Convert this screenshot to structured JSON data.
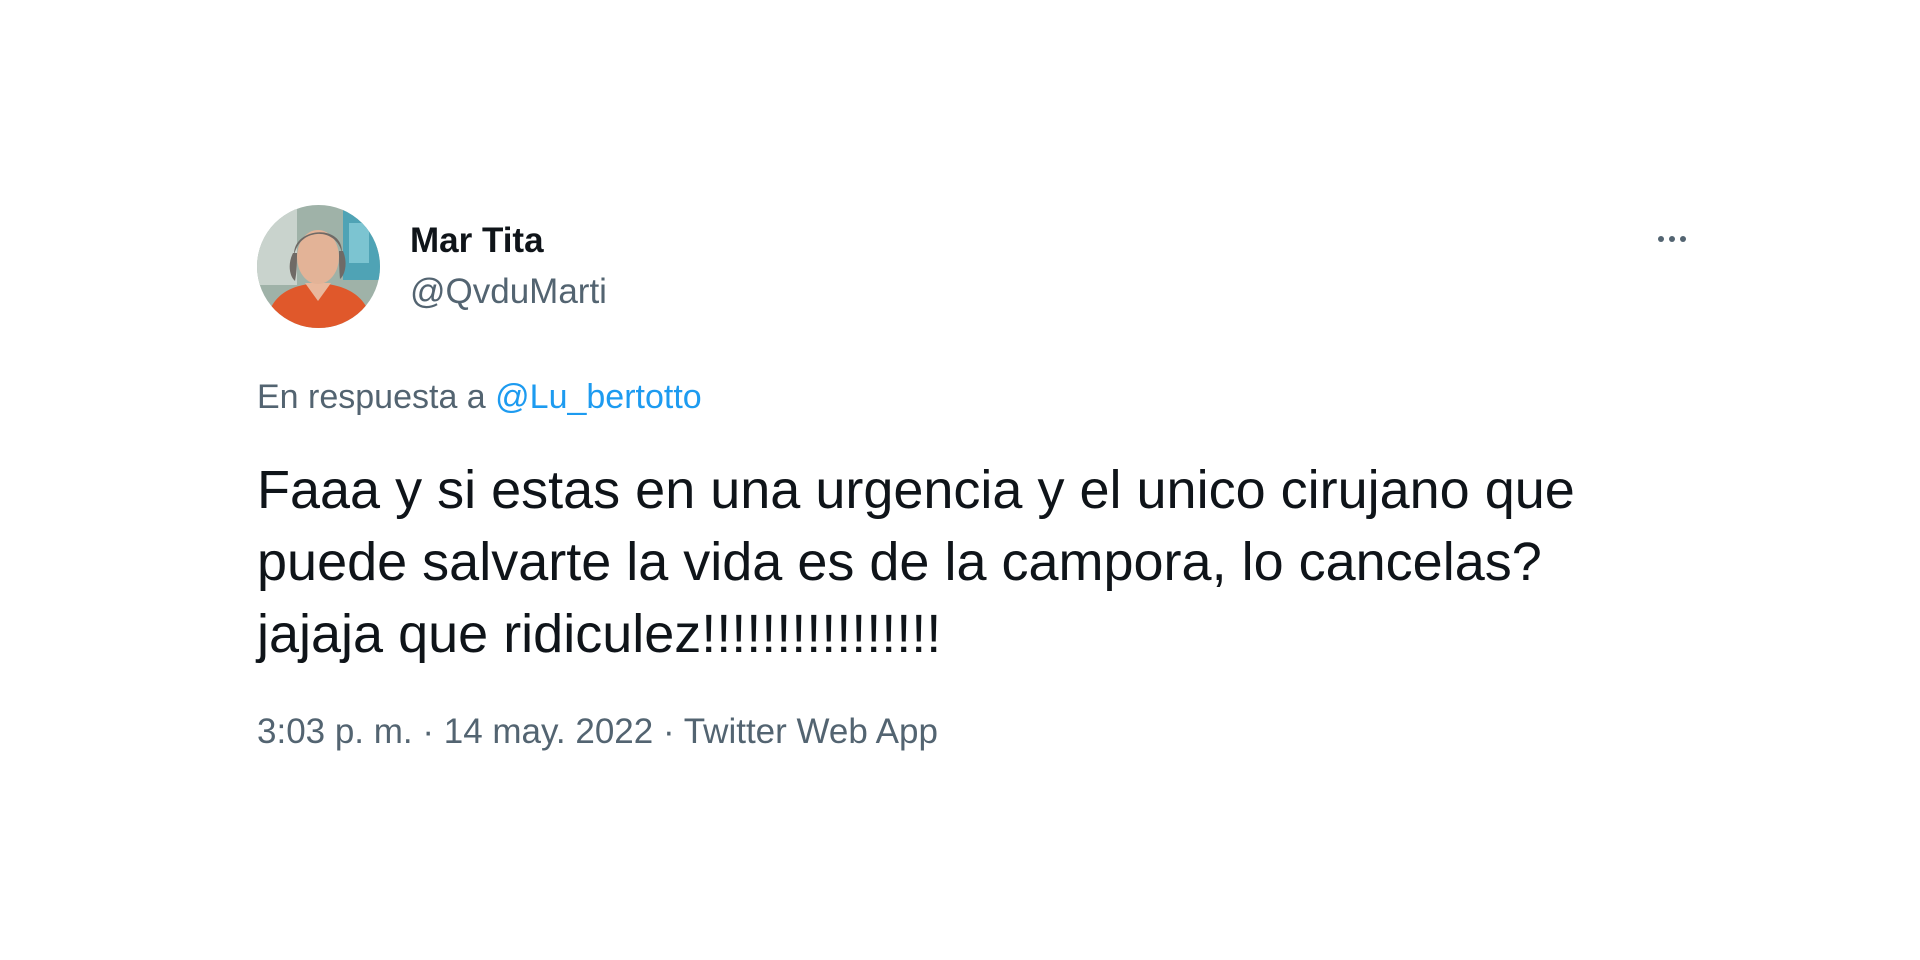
{
  "author": {
    "display_name": "Mar Tita",
    "handle": "@QvduMarti",
    "avatar_icon": "profile-photo"
  },
  "reply": {
    "prefix": "En respuesta a ",
    "mention": "@Lu_bertotto"
  },
  "tweet": {
    "text": "Faaa y si estas en una urgencia y el unico cirujano que\npuede salvarte la vida es de la campora, lo cancelas?\njajaja que ridiculez!!!!!!!!!!!!!!!!"
  },
  "meta": {
    "time": "3:03 p. m.",
    "separator": " · ",
    "date": "14 may. 2022",
    "source": "Twitter Web App"
  },
  "menu": {
    "icon": "more-horizontal-icon"
  },
  "colors": {
    "text_primary": "#0f1419",
    "text_secondary": "#536471",
    "link": "#1d9bf0",
    "background": "#ffffff"
  }
}
